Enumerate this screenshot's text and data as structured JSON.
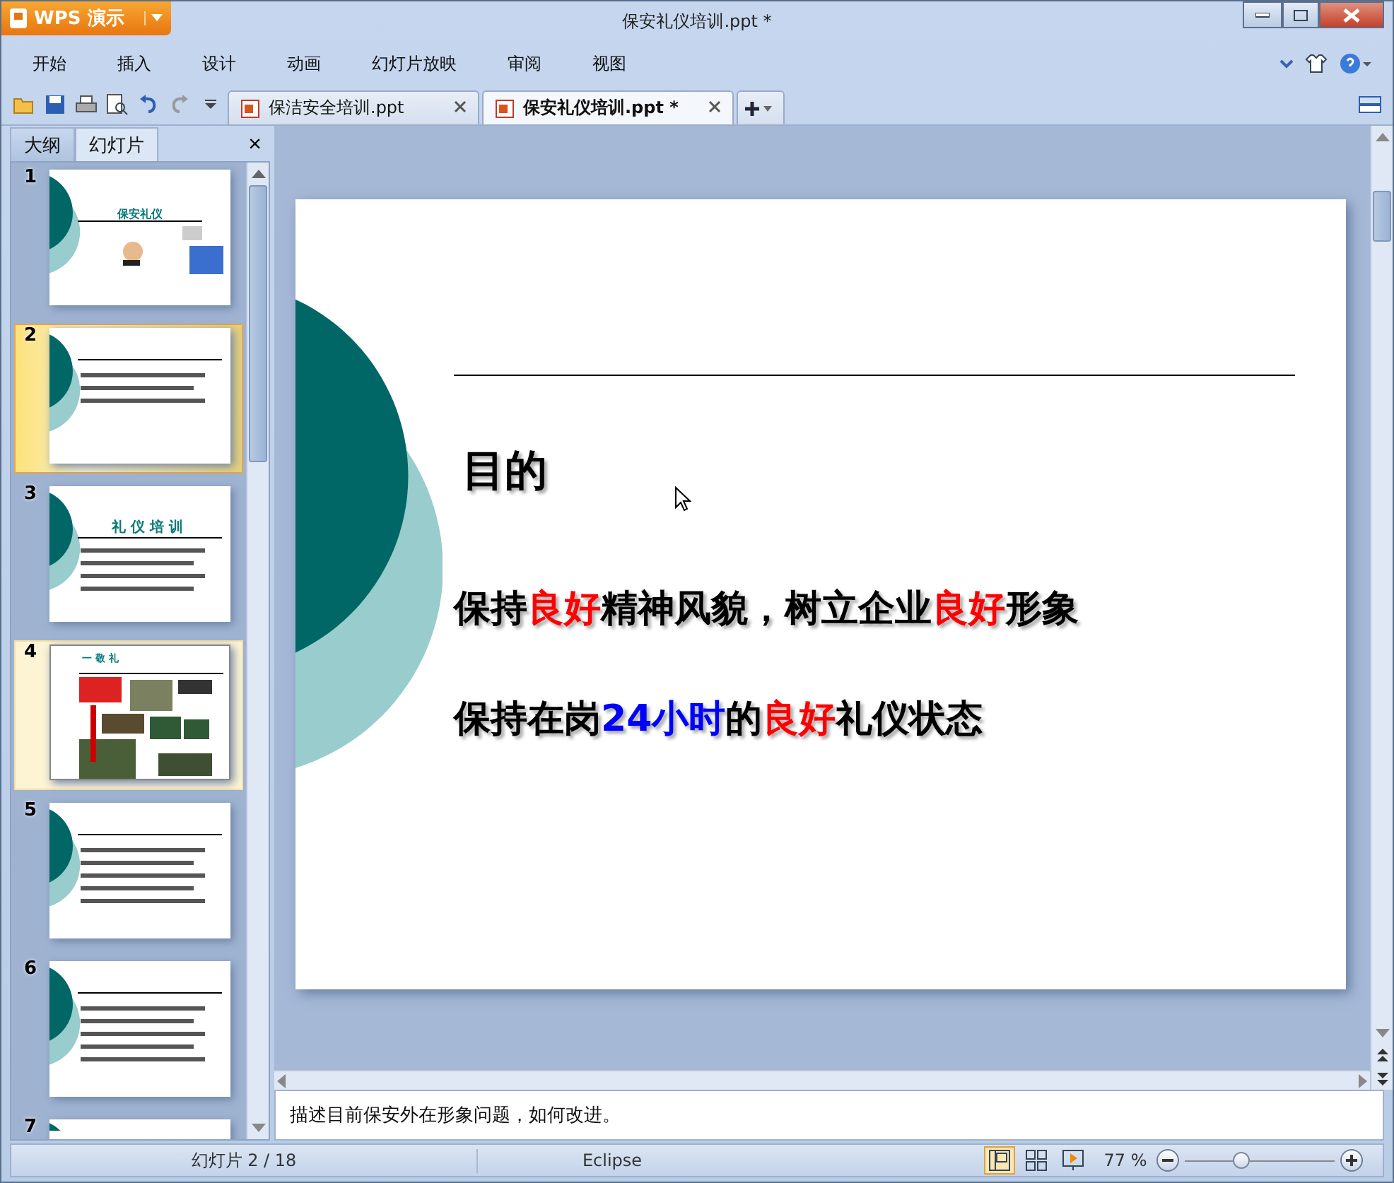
{
  "app_button": {
    "label": "WPS 演示"
  },
  "window": {
    "title": "保安礼仪培训.ppt *"
  },
  "menu": [
    {
      "label": "开始"
    },
    {
      "label": "插入"
    },
    {
      "label": "设计"
    },
    {
      "label": "动画"
    },
    {
      "label": "幻灯片放映"
    },
    {
      "label": "审阅"
    },
    {
      "label": "视图"
    }
  ],
  "doc_tabs": [
    {
      "label": "保洁安全培训.ppt",
      "selected": false
    },
    {
      "label": "保安礼仪培训.ppt *",
      "selected": true
    }
  ],
  "panel_tabs": [
    {
      "label": "大纲",
      "selected": false
    },
    {
      "label": "幻灯片",
      "selected": true
    }
  ],
  "panel_close": "×",
  "thumbnails": [
    {
      "number": "1",
      "selected": false,
      "highlighted": false,
      "kind": "cover",
      "title": "保安礼仪"
    },
    {
      "number": "2",
      "selected": true,
      "highlighted": false,
      "kind": "text"
    },
    {
      "number": "3",
      "selected": false,
      "highlighted": false,
      "kind": "toc",
      "title": "礼 仪 培 训"
    },
    {
      "number": "4",
      "selected": false,
      "highlighted": true,
      "kind": "photos",
      "title": "一 敬 礼"
    },
    {
      "number": "5",
      "selected": false,
      "highlighted": false,
      "kind": "text"
    },
    {
      "number": "6",
      "selected": false,
      "highlighted": false,
      "kind": "text"
    },
    {
      "number": "7",
      "selected": false,
      "highlighted": false,
      "kind": "text"
    }
  ],
  "slide": {
    "title": "目的",
    "lines": [
      [
        {
          "text": "保持",
          "color": "#000000"
        },
        {
          "text": "良好",
          "color": "#ff0000"
        },
        {
          "text": "精神风貌，树立企业",
          "color": "#000000"
        },
        {
          "text": "良好",
          "color": "#ff0000"
        },
        {
          "text": "形象",
          "color": "#000000"
        }
      ],
      [
        {
          "text": "保持在岗",
          "color": "#000000"
        },
        {
          "text": "24小时",
          "color": "#0000ff"
        },
        {
          "text": "的",
          "color": "#000000"
        },
        {
          "text": "良好",
          "color": "#ff0000"
        },
        {
          "text": "礼仪状态",
          "color": "#000000"
        }
      ]
    ]
  },
  "notes": "描述目前保安外在形象问题，如何改进。",
  "status_bar": {
    "slide_count": "幻灯片 2 / 18",
    "theme": "Eclipse",
    "views": [
      {
        "kind": "normal",
        "selected": true
      },
      {
        "kind": "sorter",
        "selected": false
      },
      {
        "kind": "show",
        "selected": false
      }
    ],
    "zoom": "77 %",
    "zoom_slider": {
      "level": 0.38
    }
  }
}
